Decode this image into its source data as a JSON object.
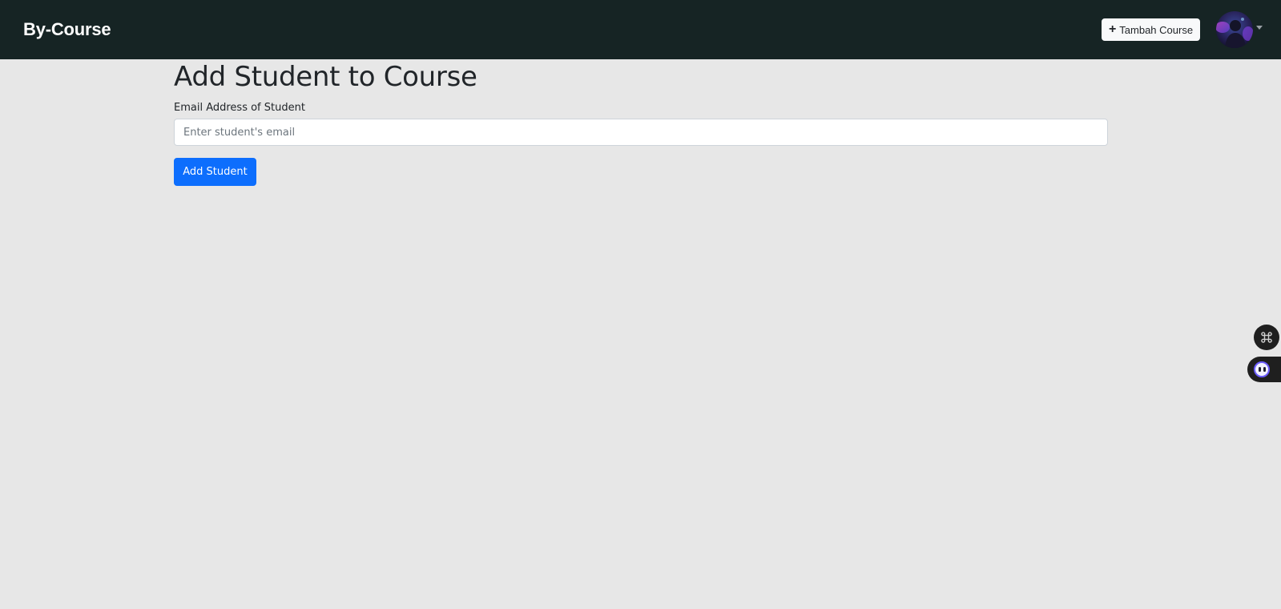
{
  "navbar": {
    "brand": "By-Course",
    "add_course_label": "Tambah Course",
    "add_course_icon": "plus-icon",
    "background": "#162424"
  },
  "form": {
    "title": "Add Student to Course",
    "email_label": "Email Address of Student",
    "email_value": "",
    "email_placeholder": "Enter student's email",
    "submit_label": "Add Student"
  },
  "floating_widgets": {
    "command_icon": "command-icon",
    "assistant_icon": "assistant-icon"
  },
  "colors": {
    "page_background": "#e7e7e7",
    "primary": "#0d6efd",
    "navbar": "#162424"
  }
}
